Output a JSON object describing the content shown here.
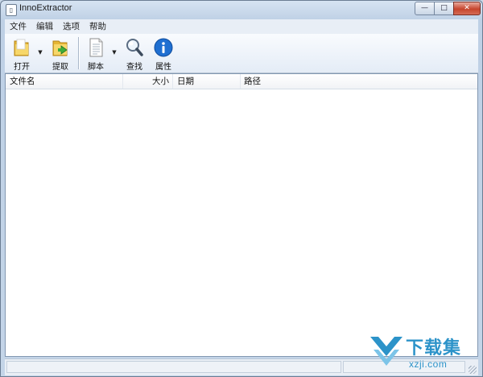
{
  "window": {
    "title": "InnoExtractor",
    "app_icon_glyph": "▯",
    "controls": {
      "minimize": "—",
      "maximize": "□",
      "close": "✕"
    }
  },
  "menu": {
    "items": [
      {
        "label": "文件"
      },
      {
        "label": "编辑"
      },
      {
        "label": "选项"
      },
      {
        "label": "帮助"
      }
    ]
  },
  "toolbar": {
    "open": {
      "label": "打开",
      "icon": "folder-open-icon",
      "has_dropdown": true
    },
    "extract": {
      "label": "提取",
      "icon": "folder-extract-icon"
    },
    "script": {
      "label": "脚本",
      "icon": "document-icon",
      "has_dropdown": true
    },
    "find": {
      "label": "查找",
      "icon": "magnifier-icon"
    },
    "properties": {
      "label": "属性",
      "icon": "info-icon"
    },
    "dropdown_glyph": "▼"
  },
  "file_list": {
    "columns": [
      "文件名",
      "大小",
      "日期",
      "路径"
    ],
    "rows": []
  },
  "watermark": {
    "title": "下载集",
    "subtitle": "xzji.com"
  },
  "colors": {
    "frame": "#c4d5e8",
    "accent_blue": "#2c93c9",
    "info_blue": "#1f6fd1",
    "folder_yellow": "#f3c84b",
    "extract_green": "#3fae3a"
  }
}
